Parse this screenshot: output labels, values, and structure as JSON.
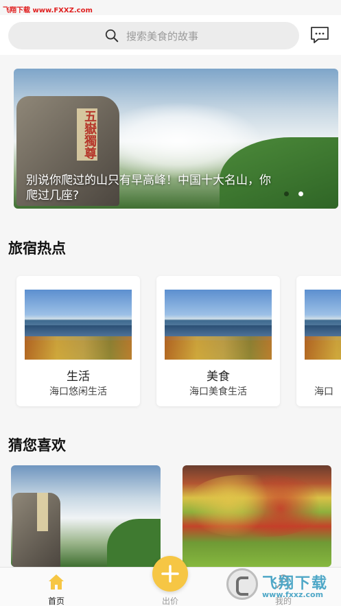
{
  "watermark": "飞翔下载 www.FXXZ.com",
  "search": {
    "placeholder": "搜索美食的故事"
  },
  "banner": {
    "caption": "别说你爬过的山只有早高峰！中国十大名山，你爬过几座?",
    "rock_inscription": "五嶽獨尊",
    "dots": 2,
    "active_dot": 1
  },
  "hot_section": {
    "title": "旅宿热点",
    "cards": [
      {
        "name": "生活",
        "subtitle": "海口悠闲生活"
      },
      {
        "name": "美食",
        "subtitle": "海口美食生活"
      },
      {
        "name": "",
        "subtitle": "海口"
      }
    ]
  },
  "like_section": {
    "title": "猜您喜欢"
  },
  "tab_bar": {
    "items": [
      {
        "label": "首页",
        "active": true
      },
      {
        "label": "出价",
        "active": false
      },
      {
        "label": "我的",
        "active": false
      }
    ]
  },
  "logo_overlay": {
    "text": "飞翔下载",
    "url": "www.fxxz.com"
  },
  "colors": {
    "accent": "#f6c644",
    "home_icon": "#f6c644",
    "watermark": "#e02020"
  }
}
